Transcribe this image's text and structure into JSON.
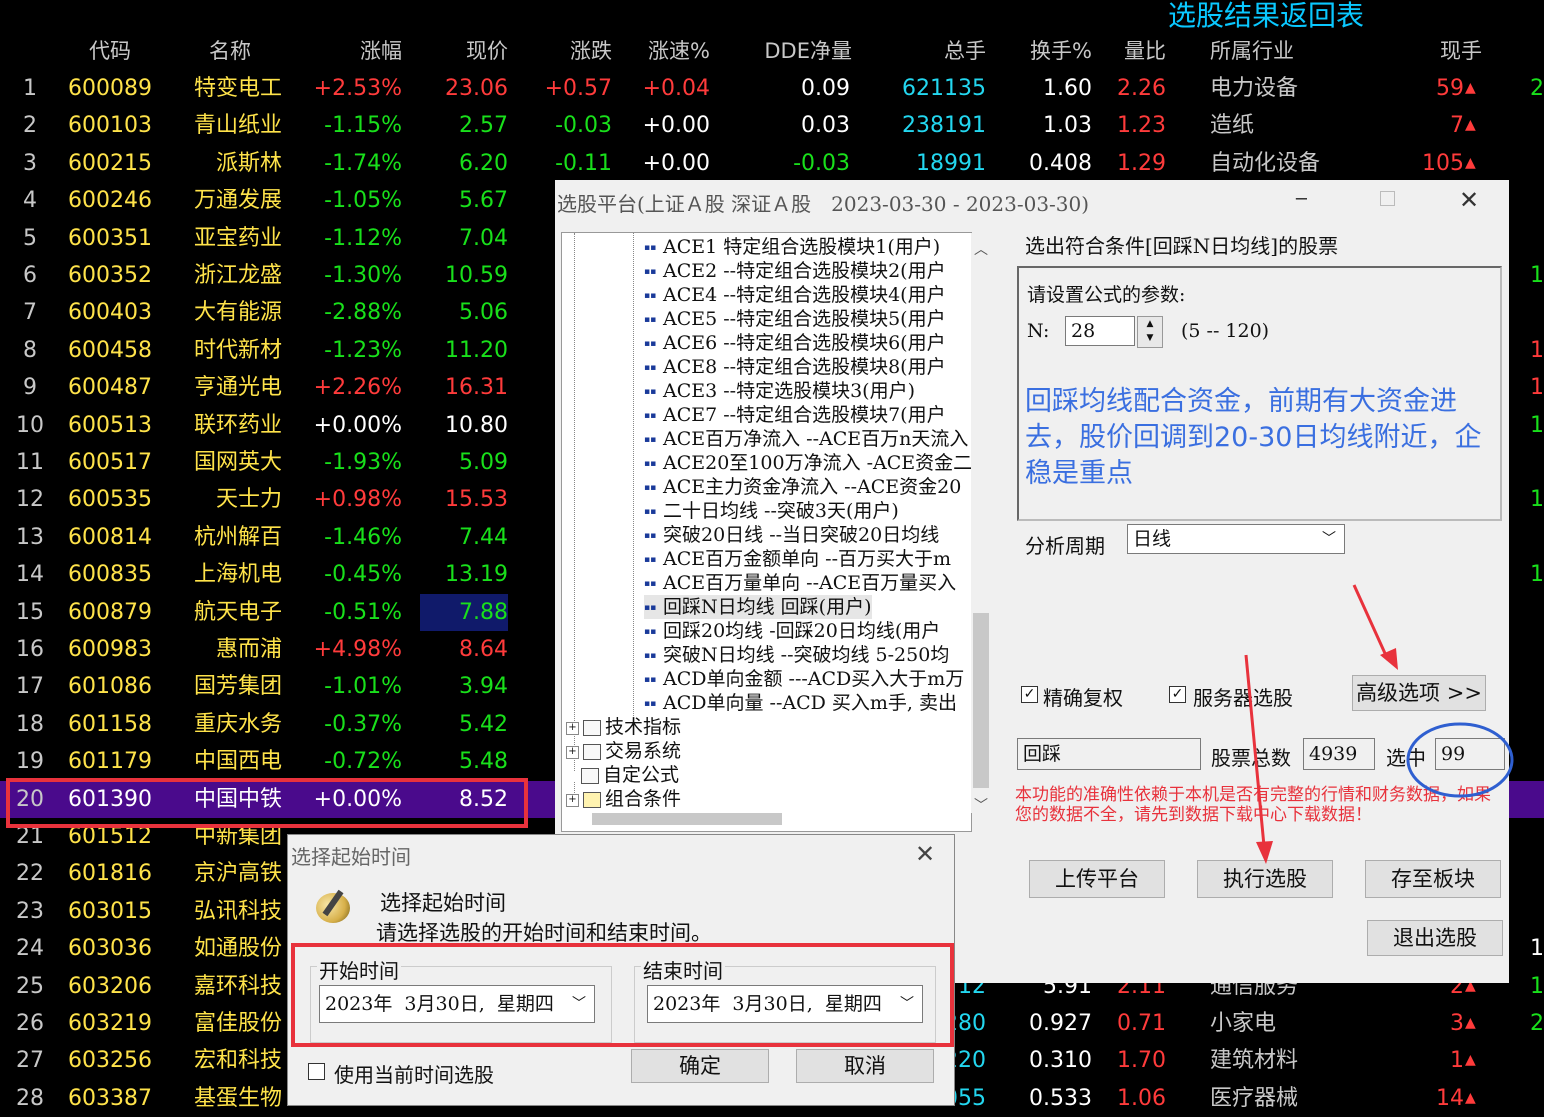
{
  "table": {
    "title": "选股结果返回表",
    "headers": [
      "代码",
      "名称",
      "涨幅",
      "现价",
      "涨跌",
      "涨速%",
      "DDE净量",
      "总手",
      "换手%",
      "量比",
      "所属行业",
      "现手"
    ],
    "rows": [
      {
        "idx": "1",
        "code": "600089",
        "name": "特变电工",
        "pct": "+2.53%",
        "price": "23.06",
        "chg": "+0.57",
        "speed": "+0.04",
        "dde": "0.09",
        "vol": "621135",
        "turn": "1.60",
        "ratio": "2.26",
        "industry": "电力设备",
        "hand": "59"
      },
      {
        "idx": "2",
        "code": "600103",
        "name": "青山纸业",
        "pct": "-1.15%",
        "price": "2.57",
        "chg": "-0.03",
        "speed": "+0.00",
        "dde": "0.03",
        "vol": "238191",
        "turn": "1.03",
        "ratio": "1.23",
        "industry": "造纸",
        "hand": "7"
      },
      {
        "idx": "3",
        "code": "600215",
        "name": "派斯林",
        "pct": "-1.74%",
        "price": "6.20",
        "chg": "-0.11",
        "speed": "+0.00",
        "dde": "-0.03",
        "vol": "18991",
        "turn": "0.408",
        "ratio": "1.29",
        "industry": "自动化设备",
        "hand": "105"
      },
      {
        "idx": "4",
        "code": "600246",
        "name": "万通发展",
        "pct": "-1.05%",
        "price": "5.67"
      },
      {
        "idx": "5",
        "code": "600351",
        "name": "亚宝药业",
        "pct": "-1.12%",
        "price": "7.04"
      },
      {
        "idx": "6",
        "code": "600352",
        "name": "浙江龙盛",
        "pct": "-1.30%",
        "price": "10.59"
      },
      {
        "idx": "7",
        "code": "600403",
        "name": "大有能源",
        "pct": "-2.88%",
        "price": "5.06"
      },
      {
        "idx": "8",
        "code": "600458",
        "name": "时代新材",
        "pct": "-1.23%",
        "price": "11.20"
      },
      {
        "idx": "9",
        "code": "600487",
        "name": "亨通光电",
        "pct": "+2.26%",
        "price": "16.31"
      },
      {
        "idx": "10",
        "code": "600513",
        "name": "联环药业",
        "pct": "+0.00%",
        "price": "10.80"
      },
      {
        "idx": "11",
        "code": "600517",
        "name": "国网英大",
        "pct": "-1.93%",
        "price": "5.09"
      },
      {
        "idx": "12",
        "code": "600535",
        "name": "天士力",
        "pct": "+0.98%",
        "price": "15.53"
      },
      {
        "idx": "13",
        "code": "600814",
        "name": "杭州解百",
        "pct": "-1.46%",
        "price": "7.44"
      },
      {
        "idx": "14",
        "code": "600835",
        "name": "上海机电",
        "pct": "-0.45%",
        "price": "13.19"
      },
      {
        "idx": "15",
        "code": "600879",
        "name": "航天电子",
        "pct": "-0.51%",
        "price": "7.88"
      },
      {
        "idx": "16",
        "code": "600983",
        "name": "惠而浦",
        "pct": "+4.98%",
        "price": "8.64"
      },
      {
        "idx": "17",
        "code": "601086",
        "name": "国芳集团",
        "pct": "-1.01%",
        "price": "3.94"
      },
      {
        "idx": "18",
        "code": "601158",
        "name": "重庆水务",
        "pct": "-0.37%",
        "price": "5.42"
      },
      {
        "idx": "19",
        "code": "601179",
        "name": "中国西电",
        "pct": "-0.72%",
        "price": "5.48"
      },
      {
        "idx": "20",
        "code": "601390",
        "name": "中国中铁",
        "pct": "+0.00%",
        "price": "8.52"
      },
      {
        "idx": "21",
        "code": "601512",
        "name": "中新集团"
      },
      {
        "idx": "22",
        "code": "601816",
        "name": "京沪高铁"
      },
      {
        "idx": "23",
        "code": "603015",
        "name": "弘讯科技"
      },
      {
        "idx": "24",
        "code": "603036",
        "name": "如通股份"
      },
      {
        "idx": "25",
        "code": "603206",
        "name": "嘉环科技",
        "vol": "12",
        "turn": "5.91",
        "ratio": "2.11",
        "industry": "通信服务",
        "hand": "2"
      },
      {
        "idx": "26",
        "code": "603219",
        "name": "富佳股份",
        "vol": "280",
        "turn": "0.927",
        "ratio": "0.71",
        "industry": "小家电",
        "hand": "3"
      },
      {
        "idx": "27",
        "code": "603256",
        "name": "宏和科技",
        "vol": "220",
        "turn": "0.310",
        "ratio": "1.70",
        "industry": "建筑材料",
        "hand": "1"
      },
      {
        "idx": "28",
        "code": "603387",
        "name": "基蛋生物",
        "pct": "-1.13%",
        "price": "13.18",
        "chg": "-0.15",
        "speed": "+0.15",
        "dde": "-0.02",
        "vol": "27055",
        "turn": "0.533",
        "ratio": "1.06",
        "industry": "医疗器械",
        "hand": "14"
      }
    ],
    "right_edge": [
      "2",
      "1",
      "1",
      "1",
      "1",
      "1",
      "1",
      "1",
      "1",
      "2"
    ]
  },
  "platform": {
    "title": "选股平台(上证Ａ股 深证Ａ股　2023-03-30 - 2023-03-30)",
    "tree_items": [
      "ACE1  特定组合选股模块1(用户)",
      "ACE2 --特定组合选股模块2(用户",
      "ACE4 --特定组合选股模块4(用户",
      "ACE5 --特定组合选股模块5(用户",
      "ACE6 --特定组合选股模块6(用户",
      "ACE8 --特定组合选股模块8(用户",
      "ACE3 --特定选股模块3(用户)",
      "ACE7 --特定组合选股模块7(用户",
      "ACE百万净流入 --ACE百万n天流入",
      "ACE20至100万净流入 -ACE资金二",
      "ACE主力资金净流入 --ACE资金20",
      "二十日均线  --突破3天(用户)",
      "突破20日线 --当日突破20日均线",
      "ACE百万金额单向 --百万买大于m",
      "ACE百万量单向 --ACE百万量买入",
      "回踩N日均线 回踩(用户)",
      "回踩20均线 -回踩20日均线(用户",
      "突破N日均线 --突破均线 5-250均",
      "ACD单向金额 ---ACD买入大于m万",
      "ACD单向量 --ACD 买入m手, 卖出"
    ],
    "tree_groups": [
      "技术指标",
      "交易系统",
      "自定公式",
      "组合条件"
    ],
    "condition_title": "选出符合条件[回踩N日均线]的股票",
    "param_label": "请设置公式的参数:",
    "n_label": "N:",
    "n_value": "28",
    "n_range": "(5 -- 120)",
    "description": "回踩均线配合资金，前期有大资金进去，股价回调到20-30日均线附近，企稳是重点",
    "period_label": "分析周期",
    "period_value": "日线",
    "exact_label": "精确复权",
    "server_label": "服务器选股",
    "advanced_label": "高级选项 >>",
    "name_field": "回踩",
    "total_label": "股票总数",
    "total_value": "4939",
    "selected_label": "选中",
    "selected_value": "99",
    "warning": "本功能的准确性依赖于本机是否有完整的行情和财务数据，如果您的数据不全，请先到数据下载中心下载数据！",
    "upload_label": "上传平台",
    "execute_label": "执行选股",
    "save_label": "存至板块",
    "exit_label": "退出选股"
  },
  "date_dialog": {
    "title": "选择起始时间",
    "heading": "选择起始时间",
    "subtitle": "请选择选股的开始时间和结束时间。",
    "start_label": "开始时间",
    "start_value": "2023年  3月30日,  星期四",
    "end_label": "结束时间",
    "end_value": "2023年  3月30日,  星期四",
    "use_current_label": "使用当前时间选股",
    "ok_label": "确定",
    "cancel_label": "取消"
  },
  "colors": {
    "up": "#ff3b3b",
    "down": "#19e01b",
    "code": "#ffe34a",
    "title": "#0ac8ff",
    "highlight_row": "#4a0a8c",
    "annotation": "#e8323c",
    "circle": "#2f5fd0",
    "description": "#3a6fe0"
  }
}
